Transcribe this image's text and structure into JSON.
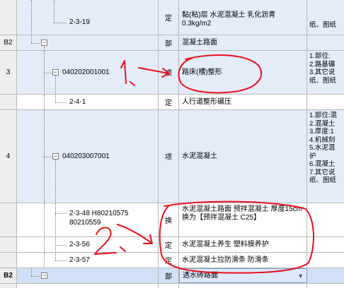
{
  "rows": {
    "r1": {
      "code": "2-3-19",
      "type": "定",
      "name": "黏(粘)层 水泥混凝土 乳化沥青 0.3kg/m2",
      "feat": "纸、图纸"
    },
    "r2": {
      "num": "B2",
      "type": "部",
      "name": "混凝土路面"
    },
    "r3": {
      "num": "3",
      "code": "040202001001",
      "type": "项",
      "name": "路床(槽)整形",
      "feat": [
        "1.部位:",
        "2.路基碾",
        "3.其它说",
        "纸、图纸"
      ]
    },
    "r4": {
      "code": "2-4-1",
      "type": "定",
      "name": "人行道整形碾压"
    },
    "r5": {
      "num": "4",
      "code": "040203007001",
      "type": "项",
      "name": "水泥混凝土",
      "feat": [
        "1.部位:混",
        "2.混凝土",
        "3.厚度:1",
        "4.机械刻",
        "5.水泥混",
        "护",
        "6.混凝土",
        "7.其它说",
        "纸、图纸"
      ]
    },
    "r6": {
      "code_line1": "2-3-48 H80210575",
      "code_line2": "80210559",
      "type": "换",
      "name": "水泥混凝土路面 预拌混凝土 厚度15cm  换为【预拌混凝土 C25】"
    },
    "r7": {
      "code": "2-3-56",
      "type": "定",
      "name": "水泥混凝土养生 塑料膜养护"
    },
    "r8": {
      "code": "2-3-57",
      "type": "定",
      "name": "水泥混凝土拉防滑条 防滑条"
    },
    "r9": {
      "num": "B2",
      "type": "部",
      "name": "透水砖路面"
    }
  },
  "annotations": {
    "label1": "1、",
    "label2": "2、"
  },
  "icons": {
    "collapse": "minus-box-icon",
    "dropdown": "dropdown-arrow-icon"
  },
  "colors": {
    "annotation_red": "#e8101a",
    "row_highlight": "#e4ecfa",
    "row_selected": "#cfe0f7"
  }
}
